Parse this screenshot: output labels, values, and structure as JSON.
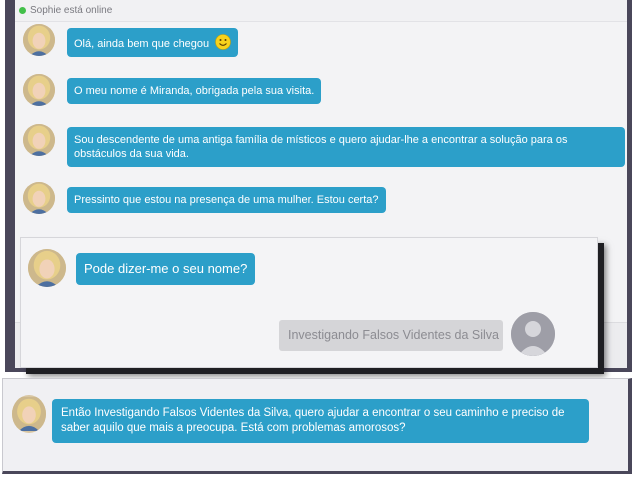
{
  "status": {
    "online_text": "Sophie está online",
    "dot_color": "#43c04a"
  },
  "chat": {
    "bubble_color": "#2c9fc9",
    "messages": [
      {
        "text": "Olá, ainda bem que chegou",
        "emoji": "smiley-icon"
      },
      {
        "text": "O meu nome é Miranda, obrigada pela sua visita."
      },
      {
        "text": "Sou descendente de uma antiga família de místicos e quero ajudar-lhe a encontrar a solução para os obstáculos da sua vida."
      },
      {
        "text": "Pressinto que estou na presença de uma mulher. Estou certa?"
      }
    ]
  },
  "popup": {
    "question": "Pode dizer-me o seu nome?",
    "user_input_value": "Investigando Falsos Videntes da Silva"
  },
  "lower": {
    "message": "Então Investigando Falsos Videntes da Silva, quero ajudar a encontrar o seu caminho e preciso de saber aquilo que mais a preocupa. Está com problemas amorosos?"
  }
}
